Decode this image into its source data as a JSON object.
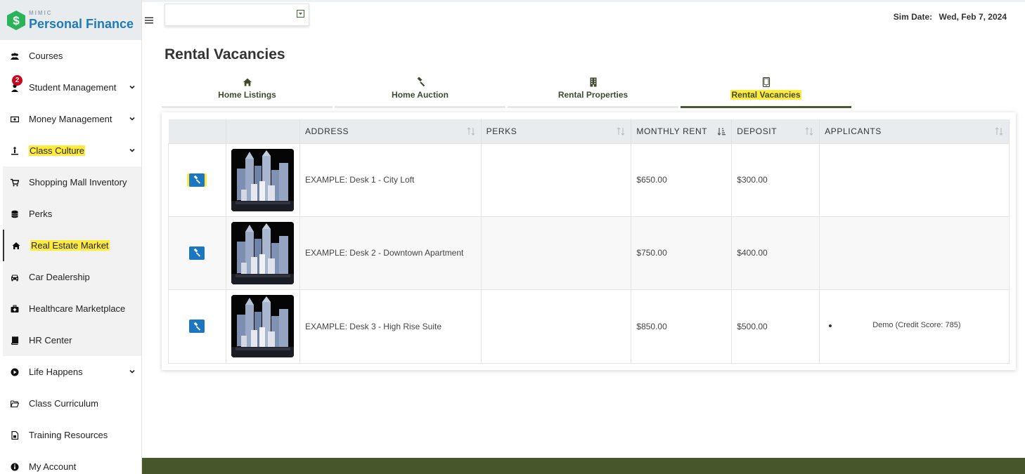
{
  "brand": {
    "mimic": "MIMIC",
    "name": "Personal Finance"
  },
  "sidebar": {
    "items": [
      {
        "label": "Courses",
        "icon": "users-icon"
      },
      {
        "label": "Student Management",
        "icon": "user-icon",
        "badge": "2"
      },
      {
        "label": "Money Management",
        "icon": "money-icon"
      },
      {
        "label": "Class Culture",
        "icon": "culture-icon"
      },
      {
        "label": "Shopping Mall Inventory",
        "icon": "cart-icon"
      },
      {
        "label": "Perks",
        "icon": "coins-icon"
      },
      {
        "label": "Real Estate Market",
        "icon": "home-icon"
      },
      {
        "label": "Car Dealership",
        "icon": "car-icon"
      },
      {
        "label": "Healthcare Marketplace",
        "icon": "medkit-icon"
      },
      {
        "label": "HR Center",
        "icon": "book-icon"
      },
      {
        "label": "Life Happens",
        "icon": "play-circle-icon"
      },
      {
        "label": "Class Curriculum",
        "icon": "folder-open-icon"
      },
      {
        "label": "Training Resources",
        "icon": "file-icon"
      },
      {
        "label": "My Account",
        "icon": "info-icon"
      }
    ]
  },
  "topbar": {
    "sim_date_label": "Sim Date:",
    "sim_date": "Wed, Feb 7, 2024"
  },
  "page": {
    "title": "Rental Vacancies"
  },
  "tabs": [
    {
      "label": "Home Listings",
      "icon": "home-icon"
    },
    {
      "label": "Home Auction",
      "icon": "gavel-icon"
    },
    {
      "label": "Rental Properties",
      "icon": "building-icon"
    },
    {
      "label": "Rental Vacancies",
      "icon": "tablet-icon",
      "active": true
    }
  ],
  "table": {
    "columns": [
      "ADDRESS",
      "PERKS",
      "MONTHLY RENT",
      "DEPOSIT",
      "APPLICANTS"
    ],
    "rows": [
      {
        "address": "EXAMPLE: Desk 1 - City Loft",
        "perks": "",
        "rent": "$650.00",
        "deposit": "$300.00",
        "applicants": ""
      },
      {
        "address": "EXAMPLE: Desk 2 - Downtown Apartment",
        "perks": "",
        "rent": "$750.00",
        "deposit": "$400.00",
        "applicants": ""
      },
      {
        "address": "EXAMPLE: Desk 3 - High Rise Suite",
        "perks": "",
        "rent": "$850.00",
        "deposit": "$500.00",
        "applicants": "Demo (Credit Score: 785)"
      }
    ]
  },
  "colors": {
    "brand_blue": "#1f7ab8",
    "accent_green": "#47562b",
    "button_blue": "#1c77c3",
    "highlight": "#ffeb3b",
    "badge_red": "#d0021b"
  }
}
